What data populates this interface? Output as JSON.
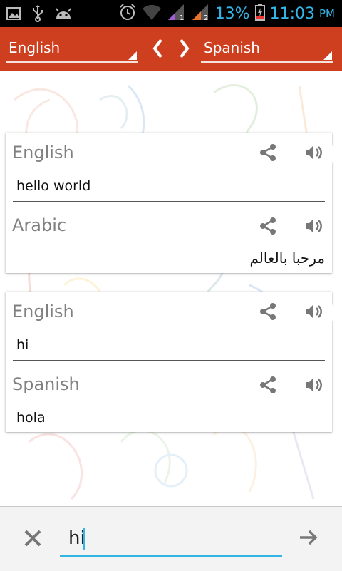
{
  "status_bar": {
    "battery_percent": "13%",
    "time": "11:03",
    "ampm": "PM",
    "icons": [
      "image-icon",
      "usb-icon",
      "android-icon",
      "alarm-icon",
      "wifi-icon",
      "signal-1-icon",
      "signal-2-icon",
      "battery-charging-icon"
    ]
  },
  "toolbar": {
    "source_language": "English",
    "target_language": "Spanish",
    "prev_arrow": "❮",
    "next_arrow": "❯",
    "color": "#ce3f1f"
  },
  "translations": [
    {
      "source": {
        "language": "English",
        "text": "hello world"
      },
      "target": {
        "language": "Arabic",
        "text": "مرحبا بالعالم"
      }
    },
    {
      "source": {
        "language": "English",
        "text": "hi"
      },
      "target": {
        "language": "Spanish",
        "text": "hola"
      }
    }
  ],
  "input": {
    "value": "hi",
    "accent": "#33b5e5"
  }
}
